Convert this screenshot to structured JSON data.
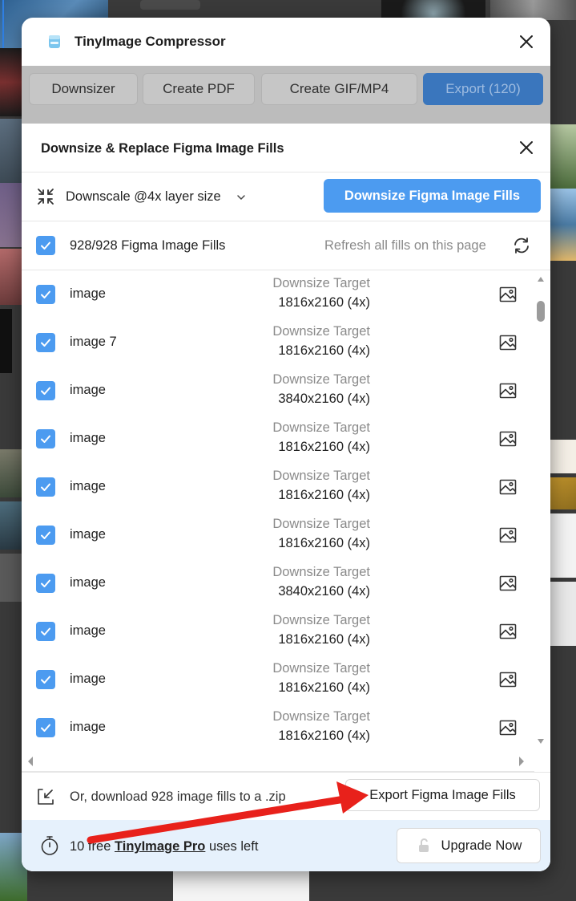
{
  "window": {
    "title": "TinyImage Compressor",
    "logo_icon": "tinyimage-logo-icon",
    "close_icon": "close-icon"
  },
  "tabs": [
    {
      "label": "Downsizer"
    },
    {
      "label": "Create PDF"
    },
    {
      "label": "Create GIF/MP4"
    },
    {
      "label": "Export (120)"
    }
  ],
  "panel": {
    "title": "Downsize & Replace Figma Image Fills",
    "close_icon": "close-icon"
  },
  "toolbar": {
    "scale_icon": "shrink-arrows-icon",
    "scale_label": "Downscale @4x layer size",
    "chevron_icon": "chevron-down-icon",
    "primary_button": "Downsize Figma Image Fills"
  },
  "select_all": {
    "checked": true,
    "label": "928/928 Figma Image Fills",
    "refresh_label": "Refresh all fills on this page",
    "refresh_icon": "refresh-icon"
  },
  "list": {
    "target_label": "Downsize Target",
    "row_icon": "image-icon",
    "rows": [
      {
        "name": "image",
        "target": "1816x2160 (4x)",
        "checked": true
      },
      {
        "name": "image 7",
        "target": "1816x2160 (4x)",
        "checked": true
      },
      {
        "name": "image",
        "target": "3840x2160 (4x)",
        "checked": true
      },
      {
        "name": "image",
        "target": "1816x2160 (4x)",
        "checked": true
      },
      {
        "name": "image",
        "target": "1816x2160 (4x)",
        "checked": true
      },
      {
        "name": "image",
        "target": "1816x2160 (4x)",
        "checked": true
      },
      {
        "name": "image",
        "target": "3840x2160 (4x)",
        "checked": true
      },
      {
        "name": "image",
        "target": "1816x2160 (4x)",
        "checked": true
      },
      {
        "name": "image",
        "target": "1816x2160 (4x)",
        "checked": true
      },
      {
        "name": "image",
        "target": "1816x2160 (4x)",
        "checked": true
      }
    ]
  },
  "zip": {
    "icon": "download-zip-icon",
    "label": "Or, download 928 image fills to a .zip",
    "button": "Export Figma Image Fills"
  },
  "footer": {
    "timer_icon": "timer-icon",
    "text_prefix": "10 free ",
    "link": "TinyImage Pro",
    "text_suffix": " uses left",
    "upgrade_icon": "unlock-icon",
    "upgrade_button": "Upgrade Now"
  },
  "colors": {
    "accent": "#4c9bf0",
    "export_tab": "#3a76bd",
    "footer_bg": "#e6f1fc",
    "annotation_arrow": "#e8211b"
  }
}
